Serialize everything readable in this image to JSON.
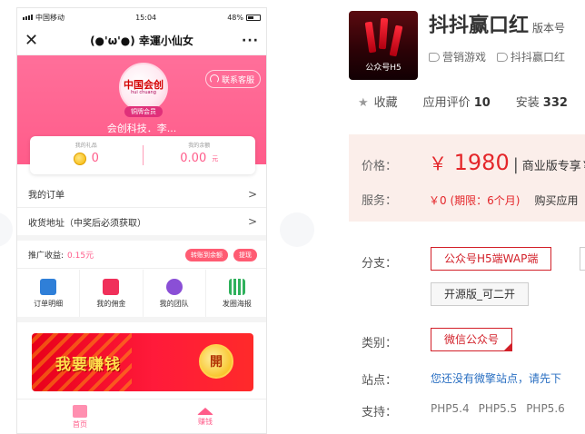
{
  "phone": {
    "status": {
      "carrier": "中国移动",
      "time": "15:04",
      "battery": "48%"
    },
    "nav": {
      "close": "✕",
      "title": "(●'ω'●) 幸運小仙女",
      "more": "···"
    },
    "hero": {
      "logo_text": "中国会创",
      "logo_sub": "hui chuang",
      "member_badge": "铜牌会员",
      "company": "会创科技．李...",
      "service_btn": "联系客服",
      "bg_color": "#ff5c8a"
    },
    "stats": [
      {
        "label": "我的礼品",
        "value": "0"
      },
      {
        "label": "我的余额",
        "value": "0.00",
        "unit": "元"
      }
    ],
    "menu": {
      "orders": "我的订单",
      "address": "收货地址（中奖后必须获取）"
    },
    "promo": {
      "label": "推广收益:",
      "amount": "0.15元",
      "btn_transfer": "转账到余额",
      "btn_withdraw": "提现"
    },
    "grid": [
      {
        "label": "订单明细",
        "icon": "order-detail-icon"
      },
      {
        "label": "我的佣金",
        "icon": "commission-icon"
      },
      {
        "label": "我的团队",
        "icon": "team-icon"
      },
      {
        "label": "发圈海报",
        "icon": "poster-icon"
      }
    ],
    "banner": {
      "text": "我要赚钱",
      "coin": "開"
    },
    "tabs": [
      {
        "label": "首页",
        "icon": "home-icon"
      },
      {
        "label": "赚钱",
        "icon": "earn-icon"
      }
    ]
  },
  "product": {
    "title": "抖抖赢口红",
    "version_label": "版本号",
    "thumb_label": "公众号H5",
    "tags": [
      "营销游戏",
      "抖抖赢口红"
    ],
    "favorite": "收藏",
    "rating_label": "应用评价",
    "rating_value": "10",
    "install_label": "安装",
    "install_value": "332",
    "price_label": "价格：",
    "price": "1980",
    "currency": "￥",
    "price_note": "商业版专享￥",
    "service_label": "服务：",
    "service_value": "￥0 (期限：6个月)",
    "service_note": "购买应用",
    "branch_label": "分支：",
    "branch_options": [
      "公众号H5端WAP端",
      "开源版_可二开"
    ],
    "category_label": "类别：",
    "category_value": "微信公众号",
    "site_label": "站点：",
    "site_text": "您还没有微擎站点，请先下",
    "support_label": "支持：",
    "support_versions": [
      "PHP5.4",
      "PHP5.5",
      "PHP5.6"
    ],
    "accent_color": "#e4262a"
  }
}
